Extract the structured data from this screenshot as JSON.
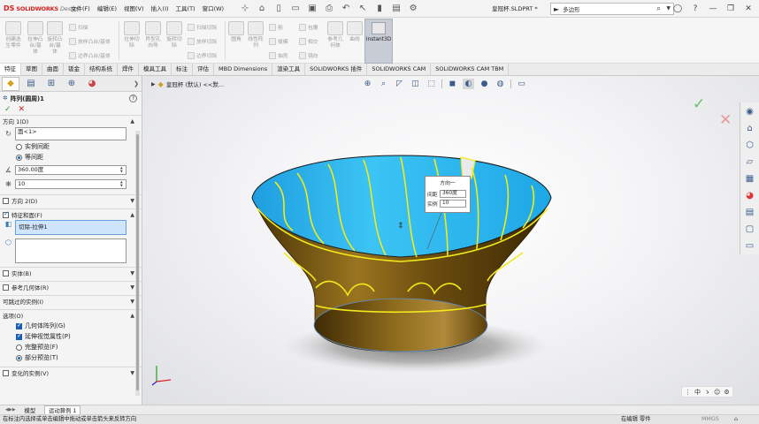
{
  "app": {
    "logo_ds": "DS",
    "logo_brand": "SOLIDWORKS",
    "logo_suffix": "Design",
    "document_title": "皇冠杯.SLDPRT *",
    "menu": [
      "文件(F)",
      "编辑(E)",
      "视图(V)",
      "插入(I)",
      "工具(T)",
      "窗口(W)"
    ],
    "search_prefix": "►",
    "search_placeholder": "多边形"
  },
  "ribbon": {
    "buttons": [
      {
        "label": "创建选\n生零件"
      },
      {
        "label": "拉伸凸\n台/基\n体"
      },
      {
        "label": "旋转凸\n台/基\n体"
      },
      {
        "label": "拉伸切\n除"
      },
      {
        "label": "异型孔\n向导"
      },
      {
        "label": "旋转切\n除"
      }
    ],
    "small": [
      "扫描",
      "放样凸台/基体",
      "边界凸台/基体",
      "扫描切除",
      "放样切除",
      "边界切除",
      "圆角",
      "线性阵\n列",
      "筋",
      "拔模",
      "抽壳",
      "包覆",
      "相交",
      "镜向",
      "参考几\n何体",
      "曲线"
    ],
    "instant3d_label": "Instant3D"
  },
  "command_tabs": [
    "特征",
    "草图",
    "曲面",
    "钣金",
    "结构系统",
    "焊件",
    "模具工具",
    "标注",
    "评估",
    "MBD Dimensions",
    "渲染工具",
    "SOLIDWORKS 插件",
    "SOLIDWORKS CAM",
    "SOLIDWORKS CAM TBM"
  ],
  "property_manager": {
    "title": "阵列(圆周)1",
    "direction1": {
      "header": "方向 1(D)",
      "axis_value": "面<1>",
      "option_instance_spacing": "实例间距",
      "option_equal_spacing": "等间距",
      "angle": "360.00度",
      "count": "10"
    },
    "direction2_header": "方向 2(D)",
    "features_header": "特征和面(F)",
    "features_list_item": "切除-拉伸1",
    "bodies_header": "实体(B)",
    "ref_geometry_header": "参考几何体(R)",
    "skip_instances_header": "可跳过的实例(I)",
    "options": {
      "header": "选项(O)",
      "geometry_pattern": "几何体阵列(G)",
      "propagate_visual": "延伸视觉属性(P)",
      "full_preview": "完整预览(F)",
      "partial_preview": "部分预览(T)"
    },
    "variable_instances_header": "变化的实例(V)"
  },
  "viewport": {
    "breadcrumb": "皇冠杯 (默认) <<默..."
  },
  "callout": {
    "title": "方向一",
    "spacing_label": "间距",
    "spacing_value": "360度",
    "instances_label": "实例",
    "instances_value": "10"
  },
  "ime": [
    "中",
    "ゝ",
    "☺",
    "⚙"
  ],
  "bottom_tabs": [
    "模型",
    "运动算例 1"
  ],
  "status": {
    "message": "在标注内选择或单击编辑中拖动或单击箭头来反转方向",
    "mode": "在编辑 零件",
    "units": "MMGS"
  },
  "colors": {
    "cup_inner": "#2fb6ee",
    "cup_outer": "#7a5a14",
    "cut_edge": "#f2ea1a",
    "accent": "#1a5fb4"
  }
}
